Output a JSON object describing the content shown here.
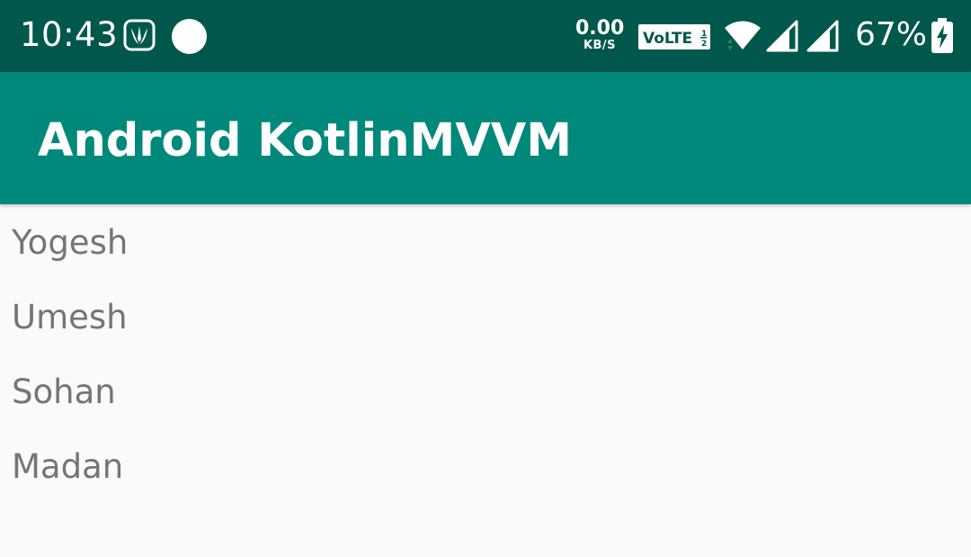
{
  "status_bar": {
    "time": "10:43",
    "net_speed_value": "0.00",
    "net_speed_unit": "KB/S",
    "volte_label": "VoLTE",
    "battery_percent": "67%",
    "icons": [
      "saavn-icon",
      "notification-dot-icon",
      "volte-icon",
      "wifi-icon",
      "signal-icon",
      "signal-icon",
      "battery-charging-icon"
    ]
  },
  "app_bar": {
    "title": "Android KotlinMVVM"
  },
  "list": {
    "items": [
      {
        "name": "Yogesh"
      },
      {
        "name": "Umesh"
      },
      {
        "name": "Sohan"
      },
      {
        "name": "Madan"
      }
    ]
  },
  "colors": {
    "status_bar": "#00574b",
    "app_bar": "#00897b",
    "background": "#fafafa",
    "list_text": "#757575"
  }
}
